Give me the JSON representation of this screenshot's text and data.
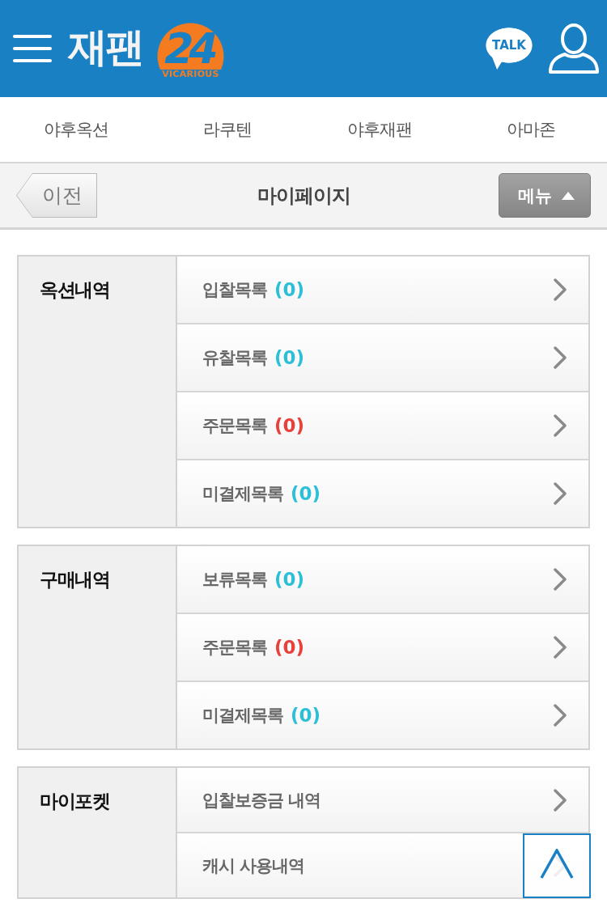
{
  "header": {
    "logo_text": "재팬",
    "logo_badge": "24",
    "logo_tagline": "VICARIOUS",
    "talk_label": "TALK"
  },
  "nav_tabs": [
    {
      "label": "야후옥션"
    },
    {
      "label": "라쿠텐"
    },
    {
      "label": "야후재팬"
    },
    {
      "label": "아마존"
    }
  ],
  "title_bar": {
    "back_label": "이전",
    "title": "마이페이지",
    "menu_label": "메뉴"
  },
  "sections": [
    {
      "title": "옥션내역",
      "rows": [
        {
          "label": "입찰목록",
          "count": "(0)",
          "color": "#2cbfd8"
        },
        {
          "label": "유찰목록",
          "count": "(0)",
          "color": "#2cbfd8"
        },
        {
          "label": "주문목록",
          "count": "(0)",
          "color": "#e8403b"
        },
        {
          "label": "미결제목록",
          "count": "(0)",
          "color": "#2cbfd8"
        }
      ]
    },
    {
      "title": "구매내역",
      "rows": [
        {
          "label": "보류목록",
          "count": "(0)",
          "color": "#2cbfd8"
        },
        {
          "label": "주문목록",
          "count": "(0)",
          "color": "#e8403b"
        },
        {
          "label": "미결제목록",
          "count": "(0)",
          "color": "#2cbfd8"
        }
      ]
    },
    {
      "title": "마이포켓",
      "rows": [
        {
          "label": "입찰보증금 내역"
        },
        {
          "label": "캐시 사용내역"
        }
      ]
    }
  ]
}
